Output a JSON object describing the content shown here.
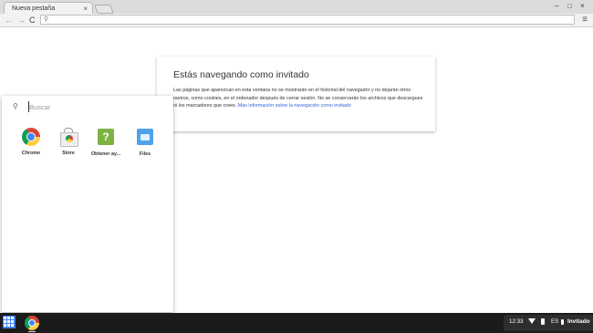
{
  "browser": {
    "tab": {
      "title": "Nueva pestaña",
      "close": "×"
    },
    "window_controls": {
      "minimize": "–",
      "maximize": "□",
      "close": "×"
    },
    "nav": {
      "back": "←",
      "forward": "→",
      "reload": "C"
    },
    "omnibox": {
      "value": "",
      "icon": "search-icon"
    },
    "menu": "≡"
  },
  "incognito": {
    "title": "Estás navegando como invitado",
    "body": "Las páginas que aparezcan en esta ventana no se mostrarán en el historial del navegador y no dejarán otros rastros, como cookies, en el ordenador después de cerrar sesión. No se conservarán los archivos que descargues ni los marcadores que crees.",
    "link": "Más información sobre la navegación como invitado"
  },
  "launcher": {
    "search_placeholder": "Buscar",
    "apps": [
      {
        "label": "Chrome",
        "icon": "chrome-icon"
      },
      {
        "label": "Store",
        "icon": "store-icon"
      },
      {
        "label": "Obtener ay...",
        "icon": "help-icon"
      },
      {
        "label": "Files",
        "icon": "files-icon"
      }
    ]
  },
  "shelf": {
    "tray": {
      "time": "12:33",
      "language": "ES",
      "user": "Invitado"
    }
  },
  "colors": {
    "accent": "#4285f4",
    "link": "#3367d6",
    "shelf": "#1b1b1b"
  }
}
